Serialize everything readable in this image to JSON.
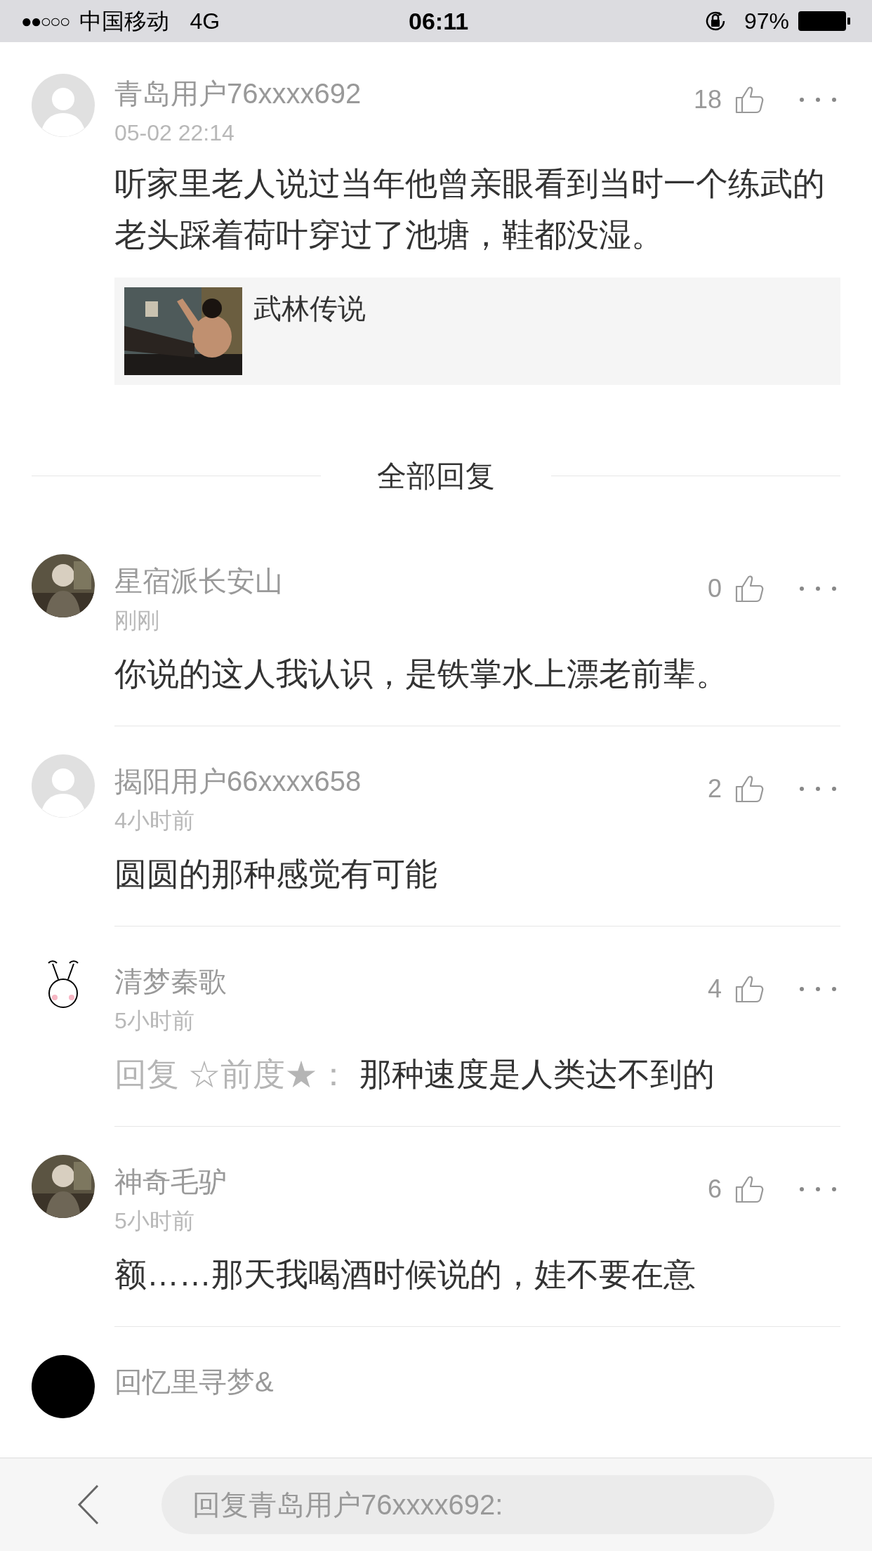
{
  "status_bar": {
    "signal": "●●○○○",
    "carrier": "中国移动",
    "network": "4G",
    "time": "06:11",
    "battery": "97%"
  },
  "comment": {
    "avatar": {
      "kind": "default"
    },
    "user": "青岛用户76xxxx692",
    "time": "05-02 22:14",
    "likes": "18",
    "text": "听家里老人说过当年他曾亲眼看到当时一个练武的老头踩着荷叶穿过了池塘，鞋都没湿。",
    "card": {
      "kind": "picture",
      "title": "武林传说"
    }
  },
  "replies_header": "全部回复",
  "replies": [
    {
      "user": "星宿派长安山",
      "time": "刚刚",
      "likes": "0",
      "text": "你说的这人我认识，是铁掌水上漂老前辈。"
    },
    {
      "avatar": {
        "kind": "default"
      },
      "user": "揭阳用户66xxxx658",
      "time": "4小时前",
      "likes": "2",
      "text": "圆圆的那种感觉有可能"
    },
    {
      "avatar": {
        "kind": "cartoon"
      },
      "user": "清梦秦歌",
      "time": "5小时前",
      "likes": "4",
      "reply_to": "回复 ☆前度★：",
      "text": "那种速度是人类达不到的"
    },
    {
      "user": "神奇毛驴",
      "time": "5小时前",
      "likes": "6",
      "text": "额……那天我喝酒时候说的，娃不要在意"
    },
    {
      "avatar": {
        "kind": "plain"
      },
      "user": "回忆里寻梦&"
    }
  ],
  "reply_bar": {
    "placeholder": "回复青岛用户76xxxx692:"
  }
}
